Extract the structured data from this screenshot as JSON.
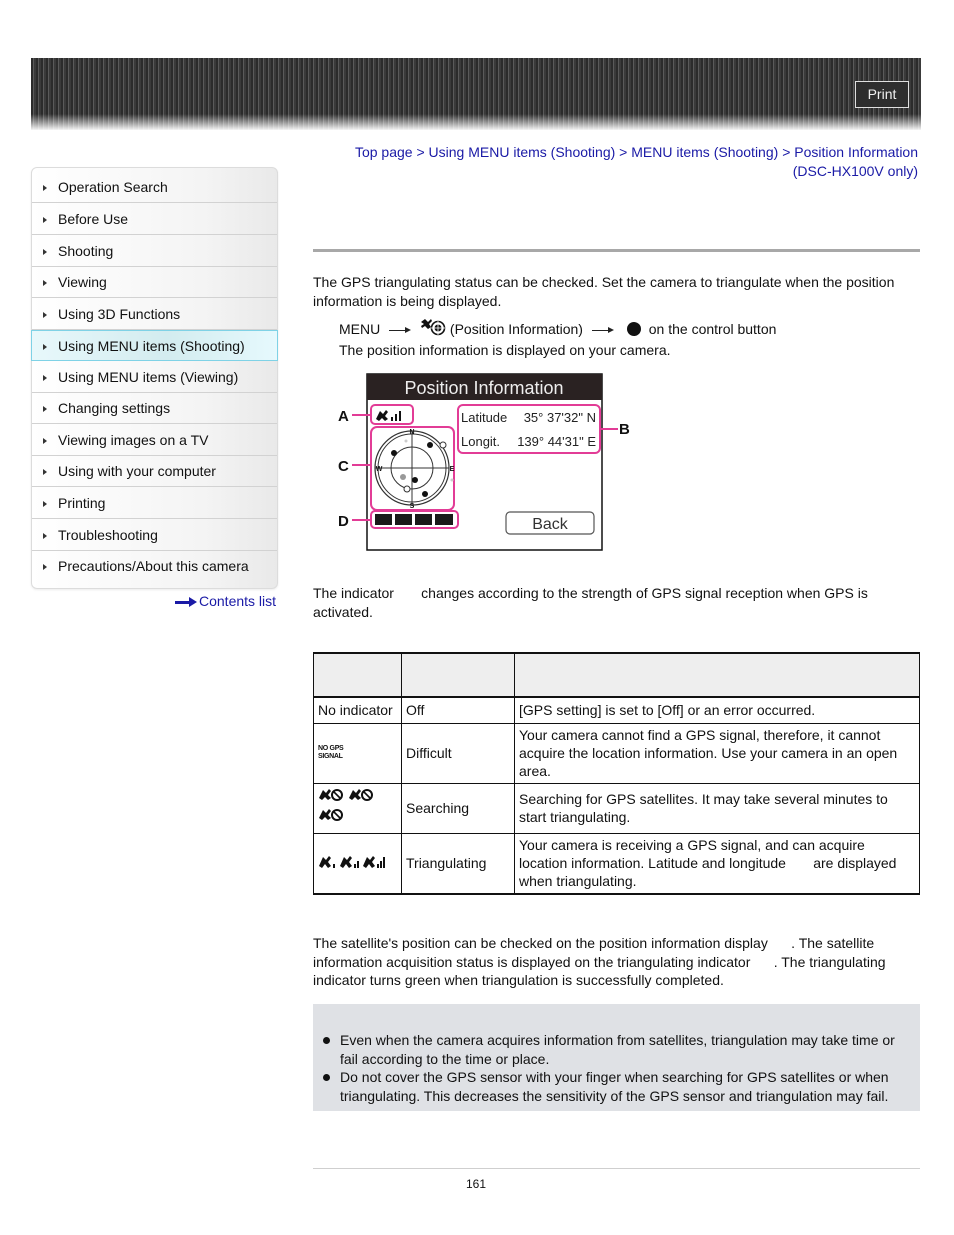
{
  "header": {
    "print_label": "Print"
  },
  "sidebar": {
    "items": [
      {
        "label": "Operation Search",
        "active": false
      },
      {
        "label": "Before Use",
        "active": false
      },
      {
        "label": "Shooting",
        "active": false
      },
      {
        "label": "Viewing",
        "active": false
      },
      {
        "label": "Using 3D Functions",
        "active": false
      },
      {
        "label": "Using MENU items (Shooting)",
        "active": true
      },
      {
        "label": "Using MENU items (Viewing)",
        "active": false
      },
      {
        "label": "Changing settings",
        "active": false
      },
      {
        "label": "Viewing images on a TV",
        "active": false
      },
      {
        "label": "Using with your computer",
        "active": false
      },
      {
        "label": "Printing",
        "active": false
      },
      {
        "label": "Troubleshooting",
        "active": false
      },
      {
        "label": "Precautions/About this camera",
        "active": false
      }
    ],
    "contents_link": "Contents list"
  },
  "breadcrumb": {
    "items": [
      "Top page",
      "Using MENU items (Shooting)",
      "MENU items (Shooting)",
      "Position Information (DSC-HX100V only)"
    ],
    "separator": ">"
  },
  "intro": {
    "text": "The GPS triangulating status can be checked. Set the camera to triangulate when the position information is being displayed.",
    "step_menu": "MENU",
    "step_item": "(Position Information)",
    "step_control": "on the control button",
    "step_result": "The position information is displayed on your camera."
  },
  "camera_screen": {
    "title": "Position Information",
    "latitude_label": "Latitude",
    "latitude_value": "35° 37'32\" N",
    "longitude_label": "Longit.",
    "longitude_value": "139° 44'31\" E",
    "back_label": "Back",
    "compass": [
      "N",
      "E",
      "S",
      "W"
    ],
    "callouts": [
      "A",
      "B",
      "C",
      "D"
    ],
    "highlight_color": "#e23c96"
  },
  "indicator_text": {
    "line": "The indicator       changes according to the strength of GPS signal reception when GPS is activated."
  },
  "table": {
    "headers": [
      "",
      "",
      ""
    ],
    "rows": [
      {
        "icon": "none",
        "indicator": "No indicator",
        "status": "Off",
        "description": "[GPS setting] is set to [Off] or an error occurred."
      },
      {
        "icon": "no-gps-signal-icon",
        "indicator_text": "NO GPS SIGNAL",
        "status": "Difficult",
        "description": "Your camera cannot find a GPS signal, therefore, it cannot acquire the location information. Use your camera in an open area."
      },
      {
        "icon": "gps-searching-icon",
        "status": "Searching",
        "description": "Searching for GPS satellites. It may take several minutes to start triangulating."
      },
      {
        "icon": "gps-triangulating-icon",
        "status": "Triangulating",
        "description": "Your camera is receiving a GPS signal, and can acquire location information. Latitude and longitude       are displayed when triangulating."
      }
    ]
  },
  "satellite_text": "The satellite's position can be checked on the position information display      . The satellite information acquisition status is displayed on the triangulating indicator      . The triangulating indicator turns green when triangulation is successfully completed.",
  "notes": [
    "Even when the camera acquires information from satellites, triangulation may take time or fail according to the time or place.",
    "Do not cover the GPS sensor with your finger when searching for GPS satellites or when triangulating. This decreases the sensitivity of the GPS sensor and triangulation may fail."
  ],
  "footer": {
    "page_number": "161"
  }
}
